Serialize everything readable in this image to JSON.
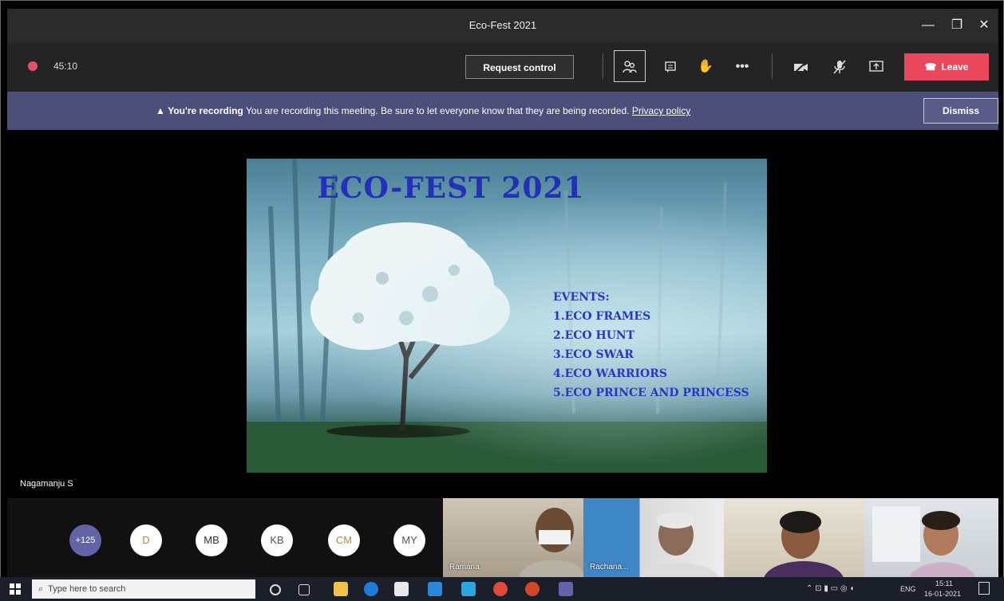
{
  "window": {
    "title": "Eco-Fest 2021",
    "minimize": "—",
    "maximize": "❐",
    "close": "✕"
  },
  "toolbar": {
    "timer": "45:10",
    "request_control": "Request control",
    "leave": "Leave",
    "icons": {
      "participants": "⛭",
      "chat": "▤",
      "raise_hand": "✋",
      "more": "•••",
      "camera_off": "⊘",
      "mic_off": "✕",
      "share": "⇪",
      "phone": "☎"
    }
  },
  "banner": {
    "title": "You're recording",
    "message": "You are recording this meeting. Be sure to let everyone know that they are being recorded.",
    "link": "Privacy policy",
    "dismiss": "Dismiss"
  },
  "slide": {
    "title": "ECO-FEST 2021",
    "events_heading": "EVENTS:",
    "events": [
      "1.ECO FRAMES",
      "2.ECO HUNT",
      "3.ECO SWAR",
      "4.ECO WARRIORS",
      "5.ECO PRINCE AND PRINCESS"
    ]
  },
  "speaker": {
    "name": "Nagamanju S"
  },
  "participants": {
    "overflow": "+125",
    "avatars": [
      {
        "initials": "D",
        "color": "#c77b4a"
      },
      {
        "initials": "MB",
        "color": "#333333"
      },
      {
        "initials": "KB",
        "color": "#555555"
      },
      {
        "initials": "CM",
        "color": "#b88a3c"
      },
      {
        "initials": "MY",
        "color": "#555555"
      }
    ],
    "video_tiles": [
      "Ramana",
      "Rachana...",
      "",
      ""
    ]
  },
  "taskbar": {
    "search_placeholder": "Type here to search",
    "time": "15:11",
    "date": "16-01-2021",
    "lang": "ENG"
  }
}
